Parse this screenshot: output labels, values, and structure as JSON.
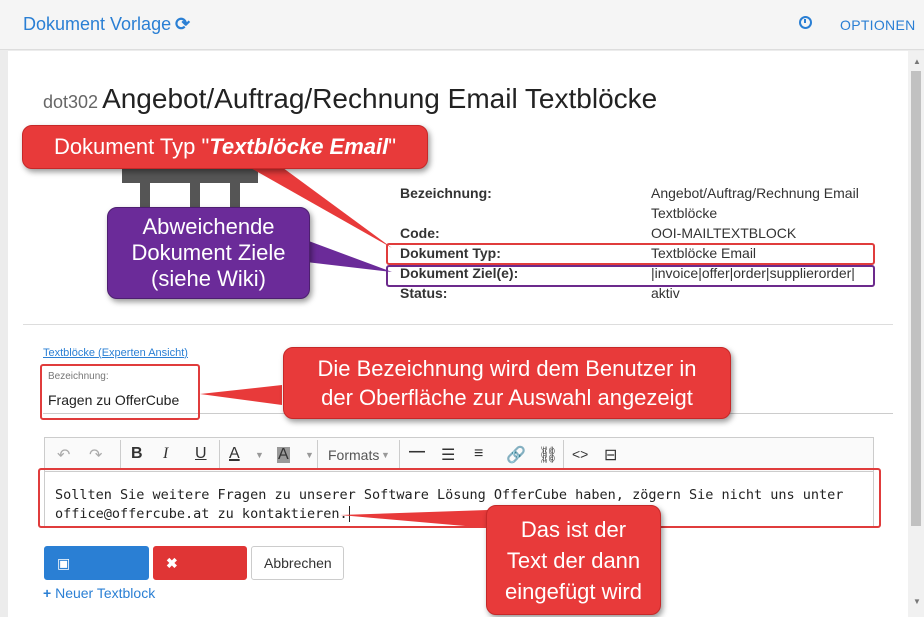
{
  "header": {
    "app_title": "Dokument Vorlage",
    "options_label": "OPTIONEN"
  },
  "page": {
    "doc_id": "dot302",
    "title": "Angebot/Auftrag/Rechnung Email Textblöcke"
  },
  "info": {
    "bezeichnung_label": "Bezeichnung:",
    "bezeichnung_value_1": "Angebot/Auftrag/Rechnung Email",
    "bezeichnung_value_2": "Textblöcke",
    "code_label": "Code:",
    "code_value": "OOI-MAILTEXTBLOCK",
    "typ_label": "Dokument Typ:",
    "typ_value": "Textblöcke Email",
    "ziel_label": "Dokument Ziel(e):",
    "ziel_value": "|invoice|offer|order|supplierorder|",
    "status_label": "Status:",
    "status_value": "aktiv"
  },
  "textblocks": {
    "link_text": "Textblöcke",
    "link_expert_open": "(",
    "link_expert": "Experten Ansicht",
    "link_expert_close": ")",
    "bez_label": "Bezeichnung:",
    "bez_value": "Fragen zu OfferCube"
  },
  "editor": {
    "formats_label": "Formats",
    "content_line_1": "Sollten Sie weitere Fragen zu unserer Software Lösung OfferCube haben, zögern Sie nicht uns unter",
    "content_line_2": "office@offercube.at zu kontaktieren."
  },
  "buttons": {
    "save": "Speichern",
    "delete": "Löschen",
    "cancel": "Abbrechen",
    "new": "Neuer Textblock"
  },
  "callouts": {
    "dokument_typ_prefix": "Dokument Typ \"",
    "dokument_typ_emph": "Textblöcke Email",
    "dokument_typ_suffix": "\"",
    "ziele_1": "Abweichende",
    "ziele_2": "Dokument Ziele",
    "ziele_3": "(siehe Wiki)",
    "bez_1": "Die Bezeichnung wird dem Benutzer in",
    "bez_2": "der Oberfläche zur Auswahl angezeigt",
    "text_1": "Das ist der",
    "text_2": "Text der dann",
    "text_3": "eingefügt wird"
  },
  "colors": {
    "accent": "#2a7fd4",
    "callout_red": "#e83a3a",
    "callout_purple": "#6b2b99"
  }
}
